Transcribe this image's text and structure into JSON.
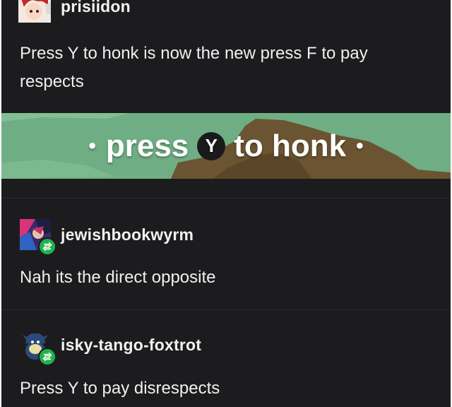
{
  "posts": [
    {
      "username": "prisiidon",
      "text": "Press Y to honk is now the new press F to pay respects",
      "avatar_icon": "anime-character-avatar"
    },
    {
      "username": "jewishbookwyrm",
      "text": "Nah its the direct opposite",
      "avatar_icon": "colorful-art-avatar",
      "reblog_icon": "reblog-icon"
    },
    {
      "username": "isky-tango-foxtrot",
      "text": "Press Y to pay disrespects",
      "avatar_icon": "pokemon-avatar",
      "reblog_icon": "reblog-icon"
    }
  ],
  "banner": {
    "word_before": "press",
    "button_letter": "Y",
    "word_after": "to honk",
    "bullet": "•"
  },
  "colors": {
    "background": "#1c1c1e",
    "banner_green": "#6fae84",
    "banner_brown": "#6b5432",
    "reblog_green": "#1fb24b"
  }
}
